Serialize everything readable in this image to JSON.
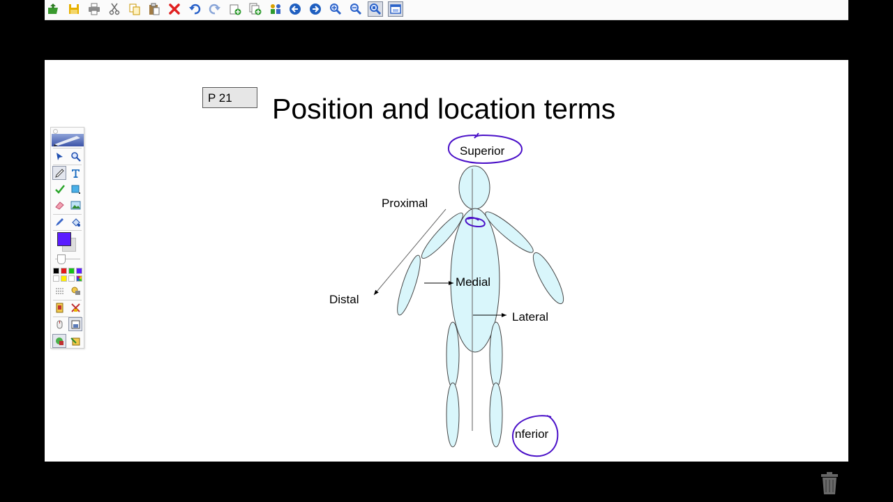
{
  "toolbar": {
    "buttons": [
      {
        "name": "open-icon",
        "color": "#3a9a2e"
      },
      {
        "name": "save-icon",
        "color": "#e6b000"
      },
      {
        "name": "print-icon",
        "color": "#6b6b6b"
      },
      {
        "name": "cut-icon",
        "color": "#6b6b6b"
      },
      {
        "name": "copy-icon",
        "color": "#d9a400"
      },
      {
        "name": "paste-icon",
        "color": "#8a6a3a"
      },
      {
        "name": "delete-icon",
        "color": "#e02020"
      },
      {
        "name": "undo-icon",
        "color": "#2a62c9"
      },
      {
        "name": "redo-icon",
        "color": "#8aa6d8"
      },
      {
        "name": "new-page-icon",
        "color": "#2e9a2e"
      },
      {
        "name": "duplicate-page-icon",
        "color": "#2e9a2e"
      },
      {
        "name": "attachments-icon",
        "color": "#3a66c8"
      },
      {
        "name": "previous-page-icon",
        "color": "#1f5fc0"
      },
      {
        "name": "next-page-icon",
        "color": "#1f5fc0"
      },
      {
        "name": "zoom-in-icon",
        "color": "#2a62c9"
      },
      {
        "name": "zoom-out-icon",
        "color": "#2a62c9"
      },
      {
        "name": "zoom-fit-icon",
        "color": "#2a62c9"
      },
      {
        "name": "full-screen-icon",
        "color": "#2a62c9"
      }
    ]
  },
  "slide": {
    "page_ref": "P 21",
    "title": "Position and location terms",
    "labels": {
      "superior": "Superior",
      "proximal": "Proximal",
      "distal": "Distal",
      "medial": "Medial",
      "lateral": "Lateral",
      "inferior": "nferior"
    },
    "body_fill": "#d9f6fb",
    "ink_color": "#4a10c8"
  },
  "palette": {
    "current_color": "#5a1cff",
    "swatches": [
      "#000000",
      "#e21b1b",
      "#17c117",
      "#5a1cff",
      "#ffffff",
      "#ffee00",
      "#ffffff",
      "#e8e8e8"
    ]
  }
}
